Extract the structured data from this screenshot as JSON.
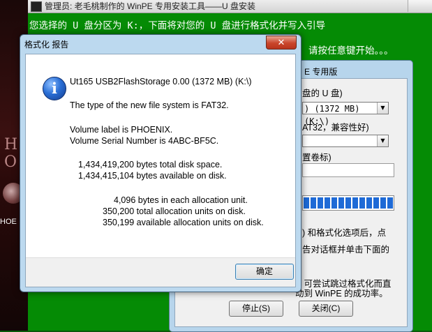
{
  "desktop": {
    "bg_text": "H O",
    "icon_label": "HOE"
  },
  "console": {
    "title": "管理员: 老毛桃制作的 WinPE 专用安装工具——U 盘安装",
    "line1": "您选择的 U 盘分区为 K:，下面将对您的 U 盘进行格式化并写入引导",
    "line2": "请按任意键开始。。。"
  },
  "installer": {
    "title_partial": "E 专用版",
    "label_udisk": "盘的 U 盘)",
    "disk_select": ") (1372 MB) (K:\\)",
    "label_fs": "AT32，兼容性好)",
    "fs_select": "",
    "label_volume": "置卷标)",
    "volume_value": "",
    "progress_percent": 100,
    "text_a": ") 和格式化选项后，点",
    "text_b": "告对话框并单击下面的",
    "text_c": "，可尝试跳过格式化而直",
    "text_d": "动到 WinPE 的成功率。",
    "stop_label": "停止(S)",
    "close_label": "关闭(C)"
  },
  "report": {
    "title": "格式化 报告",
    "close_glyph": "✕",
    "device": "Ut165 USB2FlashStorage 0.00 (1372 MB) (K:\\)",
    "fs_line": "The type of the new file system is FAT32.",
    "volume_label_line": "Volume label is PHOENIX.",
    "serial_line": "Volume Serial Number is 4ABC-BF5C.",
    "total_space_line": "1,434,419,200 bytes total disk space.",
    "available_space_line": "1,434,415,104 bytes available on disk.",
    "alloc_unit_line": "4,096 bytes in each allocation unit.",
    "total_units_line": "350,200 total allocation units on disk.",
    "available_units_line": "350,199 available allocation units on disk.",
    "ok_label": "确定"
  },
  "colors": {
    "console_bg": "#058b05",
    "info_icon": "#2a6fd6",
    "progress": "#1e6ad6"
  }
}
